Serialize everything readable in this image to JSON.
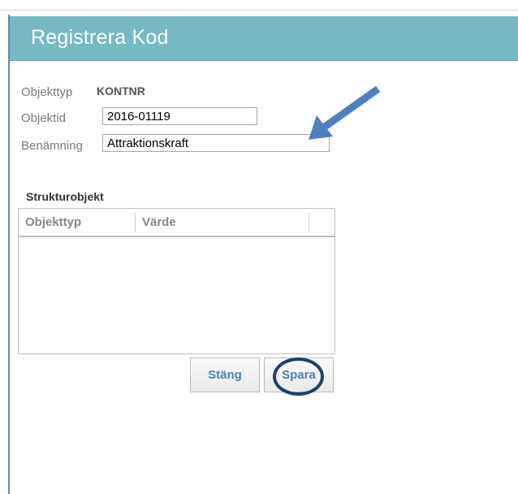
{
  "dialog": {
    "title": "Registrera Kod",
    "fields": {
      "objekttyp_label": "Objekttyp",
      "objekttyp_value": "KONTNR",
      "objektid_label": "Objektid",
      "objektid_value": "2016-01119",
      "benamning_label": "Benämning",
      "benamning_value": "Attraktionskraft"
    },
    "struktur": {
      "title": "Strukturobjekt",
      "columns": [
        "Objekttyp",
        "Värde"
      ],
      "rows": []
    },
    "buttons": {
      "close_label": "Stäng",
      "save_label": "Spara"
    }
  },
  "colors": {
    "titlebar": "#76b9c5",
    "button_text": "#4a7fc1",
    "annotation": "#1e3f6f",
    "arrow": "#4f7fc1"
  },
  "annotations": {
    "arrow_icon": "arrow-pointing-at-benamning",
    "circle_icon": "circle-around-save-button"
  }
}
